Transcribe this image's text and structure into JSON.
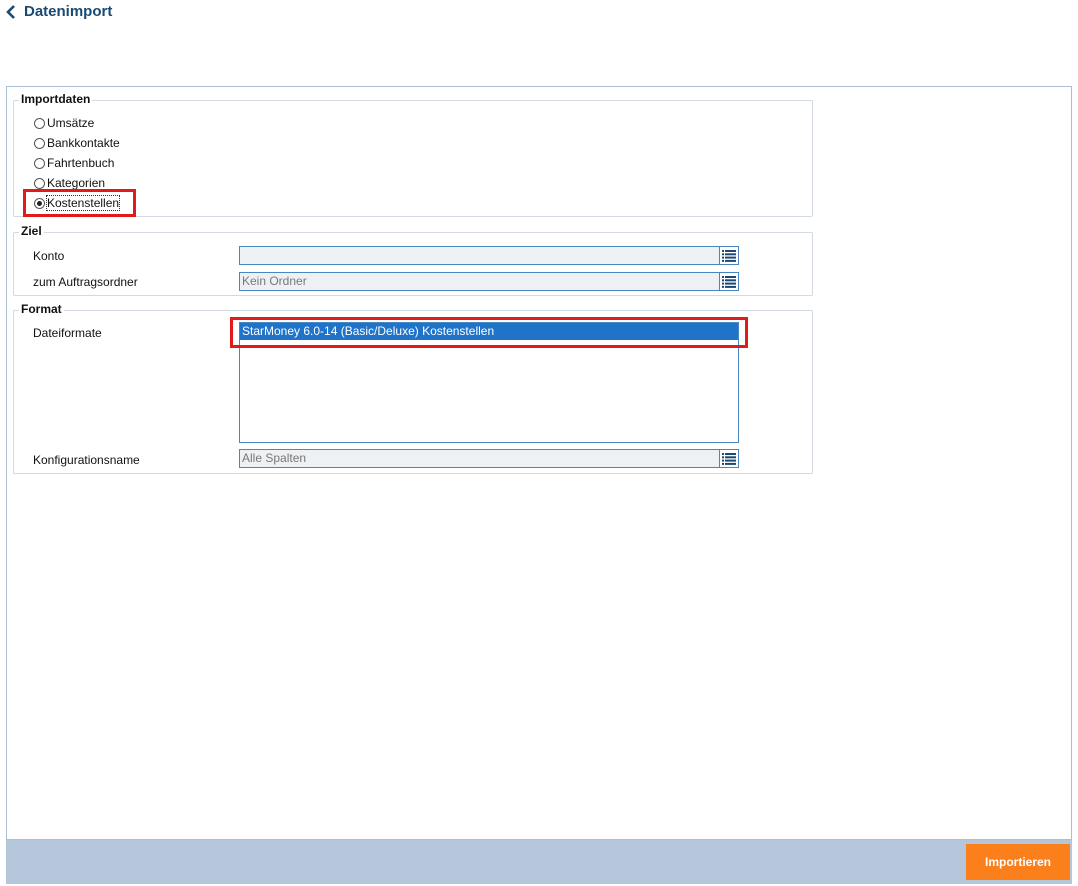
{
  "header": {
    "title": "Datenimport"
  },
  "importdaten": {
    "legend": "Importdaten",
    "options": [
      {
        "label": "Umsätze",
        "checked": false
      },
      {
        "label": "Bankkontakte",
        "checked": false
      },
      {
        "label": "Fahrtenbuch",
        "checked": false
      },
      {
        "label": "Kategorien",
        "checked": false
      },
      {
        "label": "Kostenstellen",
        "checked": true
      }
    ]
  },
  "ziel": {
    "legend": "Ziel",
    "konto_label": "Konto",
    "konto_value": "",
    "ordner_label": "zum Auftragsordner",
    "ordner_value": "Kein Ordner"
  },
  "format": {
    "legend": "Format",
    "dateiformate_label": "Dateiformate",
    "dateiformate_items": [
      "StarMoney 6.0-14 (Basic/Deluxe) Kostenstellen"
    ],
    "selected_index": 0,
    "konfig_label": "Konfigurationsname",
    "konfig_value": "Alle Spalten"
  },
  "footer": {
    "import_button": "Importieren"
  },
  "colors": {
    "accent": "#1f73c9",
    "button": "#fb7f1a",
    "footer_bg": "#b5c6da",
    "highlight": "#e01b1b"
  }
}
